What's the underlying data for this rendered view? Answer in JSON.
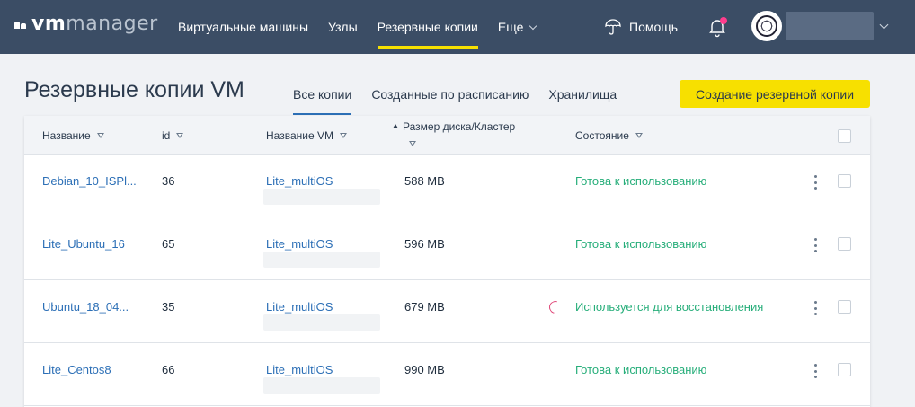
{
  "app": {
    "logo_vm": "vm",
    "logo_manager": "manager"
  },
  "nav": {
    "items": [
      "Виртуальные машины",
      "Узлы",
      "Резервные копии",
      "Еще"
    ],
    "active": "Резервные копии",
    "help_label": "Помощь"
  },
  "page": {
    "title": "Резервные копии VM",
    "tabs": [
      "Все копии",
      "Созданные по расписанию",
      "Хранилища"
    ],
    "active_tab": "Все копии",
    "create_button": "Создание резервной копии"
  },
  "table": {
    "columns": {
      "name": "Название",
      "id": "id",
      "vm_name": "Название VM",
      "disk_size": "Размер диска/Кластер",
      "state": "Состояние"
    },
    "rows": [
      {
        "name": "Debian_10_ISPl...",
        "id": "36",
        "vm_name": "Lite_multiOS",
        "disk_size": "588 MB",
        "state": "Готова к использованию",
        "busy": false
      },
      {
        "name": "Lite_Ubuntu_16",
        "id": "65",
        "vm_name": "Lite_multiOS",
        "disk_size": "596 MB",
        "state": "Готова к использованию",
        "busy": false
      },
      {
        "name": "Ubuntu_18_04...",
        "id": "35",
        "vm_name": "Lite_multiOS",
        "disk_size": "679 MB",
        "state": "Используется для восстановления",
        "busy": true
      },
      {
        "name": "Lite_Centos8",
        "id": "66",
        "vm_name": "Lite_multiOS",
        "disk_size": "990 MB",
        "state": "Готова к использованию",
        "busy": false
      }
    ]
  },
  "colors": {
    "topbar": "#3b4d65",
    "accent_yellow": "#f7e000",
    "link_blue": "#2c6fb6",
    "status_green": "#27ae7a",
    "spinner_pink": "#e04a7a",
    "notification_dot": "#ff3d8d"
  },
  "icons": {
    "help": "umbrella-icon",
    "notifications": "bell-icon",
    "filter": "filter-icon",
    "row_menu": "kebab-menu-icon"
  }
}
